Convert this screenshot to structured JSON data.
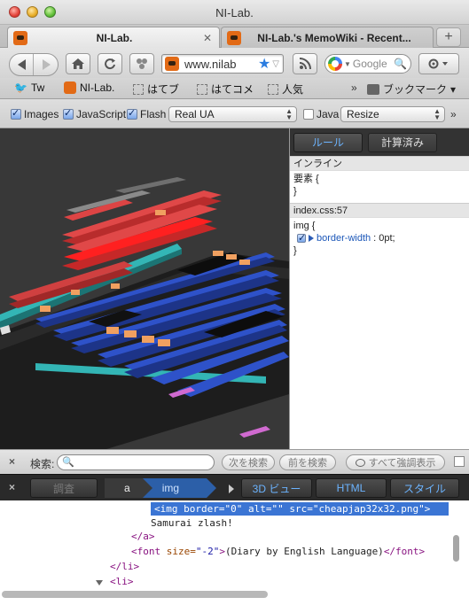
{
  "window": {
    "title": "NI-Lab."
  },
  "tabs": [
    {
      "label": "NI-Lab.",
      "active": true
    },
    {
      "label": "NI-Lab.'s MemoWiki - Recent...",
      "active": false
    }
  ],
  "toolbar": {
    "url": "www.nilab",
    "search_placeholder": "Google"
  },
  "bookmarks": {
    "items": [
      "Tw",
      "NI-Lab.",
      "はてブ",
      "はてコメ",
      "人気"
    ],
    "more": "»",
    "folder_label": "ブックマーク"
  },
  "devbar": {
    "images_label": "Images",
    "javascript_label": "JavaScript",
    "flash_label": "Flash",
    "ua_value": "Real UA",
    "java_label": "Java",
    "resize_value": "Resize",
    "more": "»"
  },
  "styles": {
    "tab_rules": "ルール",
    "tab_computed": "計算済み",
    "inline_header": "インライン",
    "inline_rule_open": "要素 {",
    "inline_rule_close": "}",
    "css_source": "index.css:57",
    "selector_open": "img {",
    "prop_name": "border-width",
    "prop_value": "0pt;",
    "selector_close": "}"
  },
  "findbar": {
    "close": "×",
    "label": "検索:",
    "next": "次を検索",
    "prev": "前を検索",
    "highlight": "すべて強調表示"
  },
  "inspector": {
    "close": "×",
    "inspect_label": "調査",
    "crumbs": [
      "a",
      "img"
    ],
    "view3d": "3D ビュー",
    "html": "HTML",
    "style": "スタイル"
  },
  "source": {
    "line1_tag_open": "<img ",
    "line1_attr1": "border=",
    "line1_val1": "\"0\"",
    "line1_attr2": " alt=",
    "line1_val2": "\"\"",
    "line1_attr3": " src=",
    "line1_val3": "\"cheapjap32x32.png\"",
    "line1_tag_close": ">",
    "line2_text": "Samurai zlash!",
    "line3_tag": "</a>",
    "line4_tag_open": "<font ",
    "line4_attr": "size=",
    "line4_val": "\"-2\"",
    "line4_close": ">",
    "line4_text": "(Diary by English Language)",
    "line4_end": "</font>",
    "line5_tag": "</li>",
    "line6_tag": "<li>"
  },
  "colors": {
    "selection": "#3b75d4",
    "accent_blue": "#6cb4ff",
    "dark_panel": "#2a2a2a"
  }
}
